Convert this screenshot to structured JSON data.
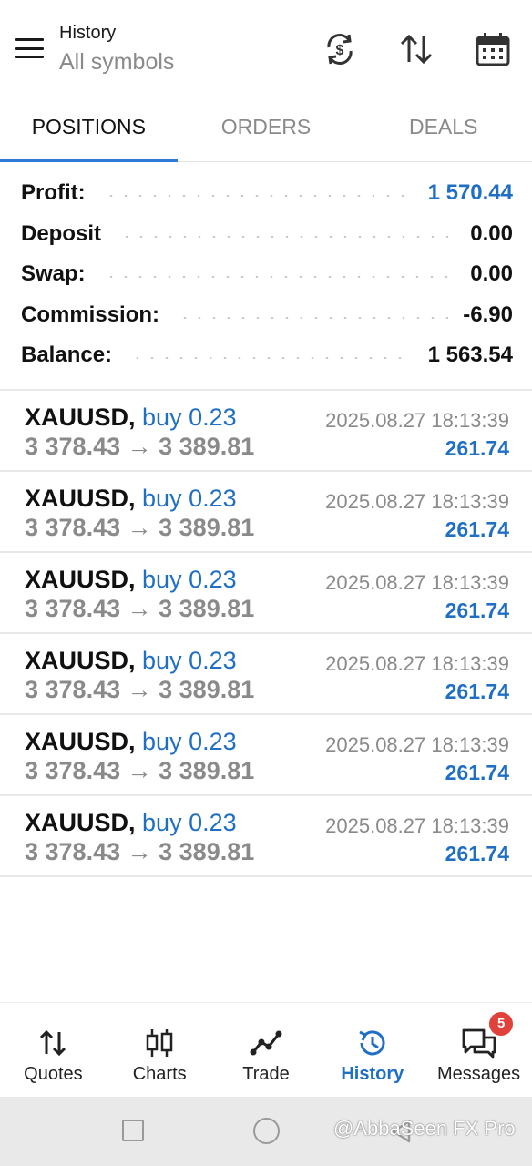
{
  "header": {
    "title": "History",
    "subtitle": "All symbols"
  },
  "tabs": [
    {
      "label": "POSITIONS",
      "active": true
    },
    {
      "label": "ORDERS",
      "active": false
    },
    {
      "label": "DEALS",
      "active": false
    }
  ],
  "summary": [
    {
      "label": "Profit:",
      "value": "1 570.44",
      "color": "#1f6fc5"
    },
    {
      "label": "Deposit",
      "value": "0.00"
    },
    {
      "label": "Swap:",
      "value": "0.00"
    },
    {
      "label": "Commission:",
      "value": "-6.90"
    },
    {
      "label": "Balance:",
      "value": "1 563.54"
    }
  ],
  "positions": [
    {
      "symbol": "XAUUSD,",
      "direction": "buy 0.23",
      "open": "3 378.43",
      "arrow": "→",
      "close": "3 389.81",
      "time": "2025.08.27 18:13:39",
      "profit": "261.74"
    },
    {
      "symbol": "XAUUSD,",
      "direction": "buy 0.23",
      "open": "3 378.43",
      "arrow": "→",
      "close": "3 389.81",
      "time": "2025.08.27 18:13:39",
      "profit": "261.74"
    },
    {
      "symbol": "XAUUSD,",
      "direction": "buy 0.23",
      "open": "3 378.43",
      "arrow": "→",
      "close": "3 389.81",
      "time": "2025.08.27 18:13:39",
      "profit": "261.74"
    },
    {
      "symbol": "XAUUSD,",
      "direction": "buy 0.23",
      "open": "3 378.43",
      "arrow": "→",
      "close": "3 389.81",
      "time": "2025.08.27 18:13:39",
      "profit": "261.74"
    },
    {
      "symbol": "XAUUSD,",
      "direction": "buy 0.23",
      "open": "3 378.43",
      "arrow": "→",
      "close": "3 389.81",
      "time": "2025.08.27 18:13:39",
      "profit": "261.74"
    },
    {
      "symbol": "XAUUSD,",
      "direction": "buy 0.23",
      "open": "3 378.43",
      "arrow": "→",
      "close": "3 389.81",
      "time": "2025.08.27 18:13:39",
      "profit": "261.74"
    }
  ],
  "bottom_nav": [
    {
      "label": "Quotes",
      "icon": "quotes-arrows-icon"
    },
    {
      "label": "Charts",
      "icon": "candlestick-icon"
    },
    {
      "label": "Trade",
      "icon": "trade-line-icon"
    },
    {
      "label": "History",
      "icon": "history-clock-icon",
      "active": true
    },
    {
      "label": "Messages",
      "icon": "chat-bubbles-icon",
      "badge": "5"
    }
  ],
  "watermark": "@AbbaSeen FX Pro",
  "colors": {
    "accent": "#1f6fc5",
    "tab_underline": "#2f7ad6",
    "badge": "#e0413a"
  }
}
